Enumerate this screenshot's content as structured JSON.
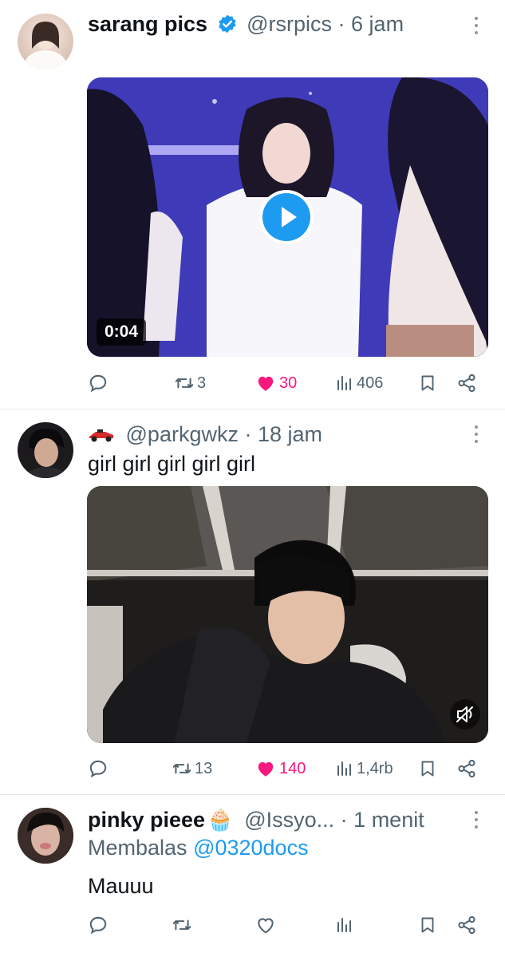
{
  "tweets": [
    {
      "name": "sarang pics",
      "verified": true,
      "handle": "@rsrpics",
      "time": "6 jam",
      "media": {
        "type": "video",
        "duration": "0:04",
        "has_play_button": true
      },
      "stats": {
        "replies": "",
        "retweets": "3",
        "likes": "30",
        "views": "406"
      },
      "liked": true
    },
    {
      "name_icon": "race-car-emoji",
      "handle": "@parkgwkz",
      "time": "18 jam",
      "text": "girl girl girl girl girl",
      "media": {
        "type": "video",
        "muted": true
      },
      "stats": {
        "replies": "",
        "retweets": "13",
        "likes": "140",
        "views": "1,4rb"
      },
      "liked": true
    },
    {
      "name": "pinky pieee",
      "name_emoji": "🧁",
      "handle": "@Issyo...",
      "time": "1 menit",
      "reply_prefix": "Membalas",
      "reply_to": "@0320docs",
      "text": "Mauuu",
      "stats": {
        "replies": "",
        "retweets": "",
        "likes": "",
        "views": ""
      },
      "liked": false
    }
  ],
  "colors": {
    "like": "#f91880",
    "link": "#1d9bf0",
    "muted": "#536471",
    "verified": "#1d9bf0"
  }
}
